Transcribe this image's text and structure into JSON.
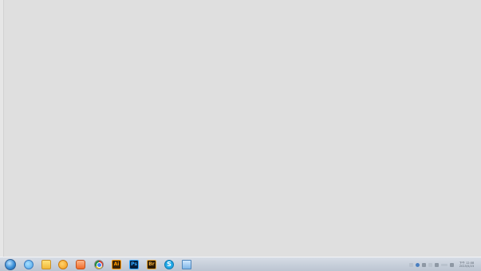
{
  "desktop": {
    "background": "#dfdfdf"
  },
  "taskbar": {
    "pinned_apps": [
      {
        "name": "start-orb"
      },
      {
        "name": "internet-explorer-icon"
      },
      {
        "name": "file-explorer-icon"
      },
      {
        "name": "media-center-icon"
      },
      {
        "name": "media-player-icon"
      },
      {
        "name": "chrome-icon"
      },
      {
        "name": "illustrator-icon",
        "label": "Ai"
      },
      {
        "name": "photoshop-icon",
        "label": "Ps"
      },
      {
        "name": "bridge-icon",
        "label": "Br"
      },
      {
        "name": "skype-icon",
        "label": "S"
      },
      {
        "name": "remote-desktop-icon"
      }
    ],
    "clock": {
      "time": "下午 12:08",
      "date": "2015/5/23"
    }
  }
}
